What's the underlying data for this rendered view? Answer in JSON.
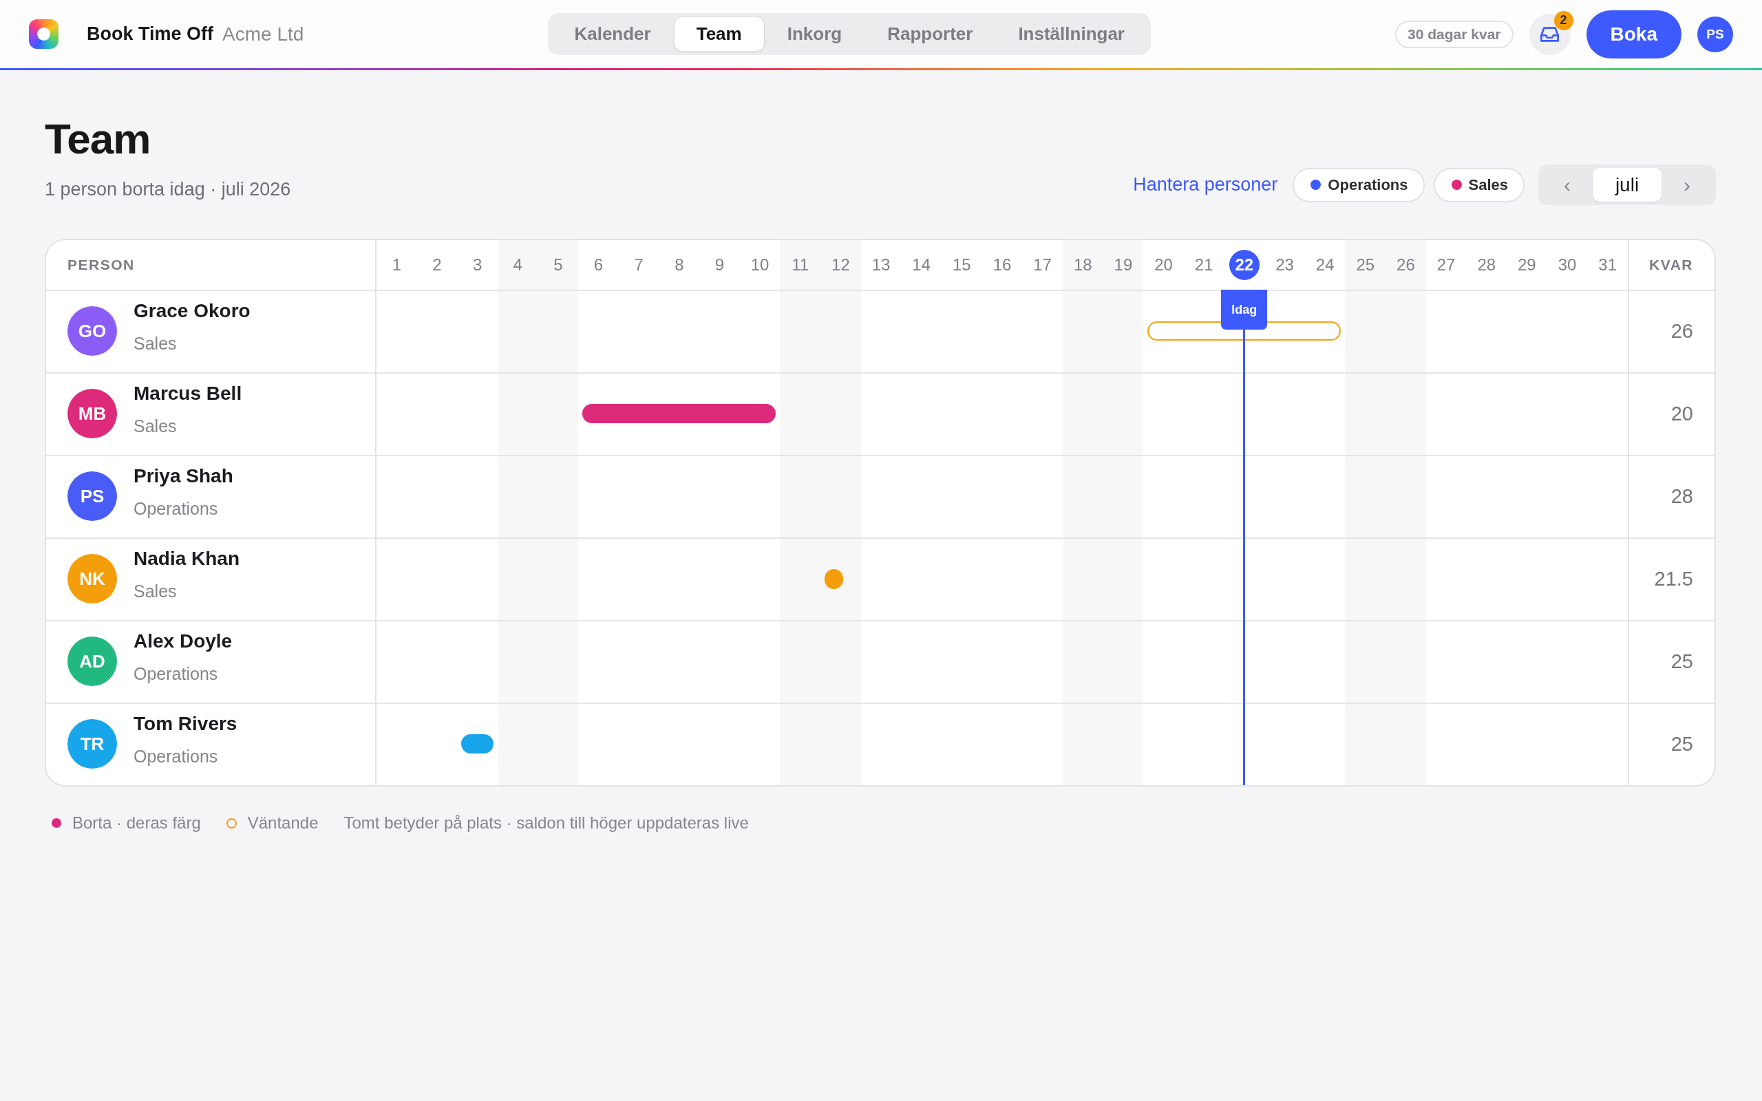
{
  "app": {
    "name": "Book Time Off",
    "org": "Acme Ltd"
  },
  "nav_tabs": [
    {
      "label": "Kalender",
      "selected": false
    },
    {
      "label": "Team",
      "selected": true
    },
    {
      "label": "Inkorg",
      "selected": false
    },
    {
      "label": "Rapporter",
      "selected": false
    },
    {
      "label": "Inställningar",
      "selected": false
    }
  ],
  "top_bar": {
    "balance": "30 dagar kvar",
    "inbox_count": "2",
    "book_button": "Boka",
    "user_initials": "PS"
  },
  "page": {
    "title": "Team",
    "subtitle": "1 person borta idag · juli 2026",
    "manage_link": "Hantera personer"
  },
  "team_filters": [
    {
      "label": "Operations",
      "color": "#3d5afe"
    },
    {
      "label": "Sales",
      "color": "#dd2a7b"
    }
  ],
  "month_nav": {
    "prev": "‹",
    "month": "juli",
    "next": "›"
  },
  "table": {
    "person_header": "PERSON",
    "balance_header": "KVAR",
    "today_label": "Idag",
    "days": [
      {
        "label": "1",
        "weekend": false,
        "today": false
      },
      {
        "label": "2",
        "weekend": false,
        "today": false
      },
      {
        "label": "3",
        "weekend": false,
        "today": false
      },
      {
        "label": "4",
        "weekend": true,
        "today": false
      },
      {
        "label": "5",
        "weekend": true,
        "today": false
      },
      {
        "label": "6",
        "weekend": false,
        "today": false
      },
      {
        "label": "7",
        "weekend": false,
        "today": false
      },
      {
        "label": "8",
        "weekend": false,
        "today": false
      },
      {
        "label": "9",
        "weekend": false,
        "today": false
      },
      {
        "label": "10",
        "weekend": false,
        "today": false
      },
      {
        "label": "11",
        "weekend": true,
        "today": false
      },
      {
        "label": "12",
        "weekend": true,
        "today": false
      },
      {
        "label": "13",
        "weekend": false,
        "today": false
      },
      {
        "label": "14",
        "weekend": false,
        "today": false
      },
      {
        "label": "15",
        "weekend": false,
        "today": false
      },
      {
        "label": "16",
        "weekend": false,
        "today": false
      },
      {
        "label": "17",
        "weekend": false,
        "today": false
      },
      {
        "label": "18",
        "weekend": true,
        "today": false
      },
      {
        "label": "19",
        "weekend": true,
        "today": false
      },
      {
        "label": "20",
        "weekend": false,
        "today": false
      },
      {
        "label": "21",
        "weekend": false,
        "today": false
      },
      {
        "label": "22",
        "weekend": false,
        "today": true
      },
      {
        "label": "23",
        "weekend": false,
        "today": false
      },
      {
        "label": "24",
        "weekend": false,
        "today": false
      },
      {
        "label": "25",
        "weekend": true,
        "today": false
      },
      {
        "label": "26",
        "weekend": true,
        "today": false
      },
      {
        "label": "27",
        "weekend": false,
        "today": false
      },
      {
        "label": "28",
        "weekend": false,
        "today": false
      },
      {
        "label": "29",
        "weekend": false,
        "today": false
      },
      {
        "label": "30",
        "weekend": false,
        "today": false
      },
      {
        "label": "31",
        "weekend": false,
        "today": false
      }
    ],
    "rows": [
      {
        "initials": "GO",
        "name": "Grace Okoro",
        "team": "Sales",
        "color": "#8b5cf6",
        "balance": "26",
        "days": [
          {
            "kind": "none"
          },
          {
            "kind": "none"
          },
          {
            "kind": "none"
          },
          {
            "kind": "none"
          },
          {
            "kind": "none"
          },
          {
            "kind": "none"
          },
          {
            "kind": "none"
          },
          {
            "kind": "none"
          },
          {
            "kind": "none"
          },
          {
            "kind": "none"
          },
          {
            "kind": "none"
          },
          {
            "kind": "none"
          },
          {
            "kind": "none"
          },
          {
            "kind": "none"
          },
          {
            "kind": "none"
          },
          {
            "kind": "none"
          },
          {
            "kind": "none"
          },
          {
            "kind": "none"
          },
          {
            "kind": "none"
          },
          {
            "kind": "pending"
          },
          {
            "kind": "pending"
          },
          {
            "kind": "pending"
          },
          {
            "kind": "pending"
          },
          {
            "kind": "pending"
          },
          {
            "kind": "none"
          },
          {
            "kind": "none"
          },
          {
            "kind": "none"
          },
          {
            "kind": "none"
          },
          {
            "kind": "none"
          },
          {
            "kind": "none"
          },
          {
            "kind": "none"
          }
        ]
      },
      {
        "initials": "MB",
        "name": "Marcus Bell",
        "team": "Sales",
        "color": "#dd2a7b",
        "balance": "20",
        "days": [
          {
            "kind": "none"
          },
          {
            "kind": "none"
          },
          {
            "kind": "none"
          },
          {
            "kind": "none"
          },
          {
            "kind": "none"
          },
          {
            "kind": "away"
          },
          {
            "kind": "away"
          },
          {
            "kind": "away"
          },
          {
            "kind": "away"
          },
          {
            "kind": "away"
          },
          {
            "kind": "none"
          },
          {
            "kind": "none"
          },
          {
            "kind": "none"
          },
          {
            "kind": "none"
          },
          {
            "kind": "none"
          },
          {
            "kind": "none"
          },
          {
            "kind": "none"
          },
          {
            "kind": "none"
          },
          {
            "kind": "none"
          },
          {
            "kind": "none"
          },
          {
            "kind": "none"
          },
          {
            "kind": "none"
          },
          {
            "kind": "none"
          },
          {
            "kind": "none"
          },
          {
            "kind": "none"
          },
          {
            "kind": "none"
          },
          {
            "kind": "none"
          },
          {
            "kind": "none"
          },
          {
            "kind": "none"
          },
          {
            "kind": "none"
          },
          {
            "kind": "none"
          }
        ]
      },
      {
        "initials": "PS",
        "name": "Priya Shah",
        "team": "Operations",
        "color": "#4a5cf6",
        "balance": "28",
        "days": [
          {
            "kind": "none"
          },
          {
            "kind": "none"
          },
          {
            "kind": "none"
          },
          {
            "kind": "none"
          },
          {
            "kind": "none"
          },
          {
            "kind": "none"
          },
          {
            "kind": "none"
          },
          {
            "kind": "none"
          },
          {
            "kind": "none"
          },
          {
            "kind": "none"
          },
          {
            "kind": "none"
          },
          {
            "kind": "none"
          },
          {
            "kind": "none"
          },
          {
            "kind": "none"
          },
          {
            "kind": "none"
          },
          {
            "kind": "none"
          },
          {
            "kind": "none"
          },
          {
            "kind": "none"
          },
          {
            "kind": "none"
          },
          {
            "kind": "none"
          },
          {
            "kind": "none"
          },
          {
            "kind": "none"
          },
          {
            "kind": "none"
          },
          {
            "kind": "none"
          },
          {
            "kind": "none"
          },
          {
            "kind": "none"
          },
          {
            "kind": "none"
          },
          {
            "kind": "none"
          },
          {
            "kind": "none"
          },
          {
            "kind": "none"
          },
          {
            "kind": "none"
          }
        ]
      },
      {
        "initials": "NK",
        "name": "Nadia Khan",
        "team": "Sales",
        "color": "#f59e0b",
        "balance": "21.5",
        "days": [
          {
            "kind": "none"
          },
          {
            "kind": "none"
          },
          {
            "kind": "none"
          },
          {
            "kind": "none"
          },
          {
            "kind": "none"
          },
          {
            "kind": "none"
          },
          {
            "kind": "none"
          },
          {
            "kind": "none"
          },
          {
            "kind": "none"
          },
          {
            "kind": "none"
          },
          {
            "kind": "none"
          },
          {
            "kind": "half"
          },
          {
            "kind": "none"
          },
          {
            "kind": "none"
          },
          {
            "kind": "none"
          },
          {
            "kind": "none"
          },
          {
            "kind": "none"
          },
          {
            "kind": "none"
          },
          {
            "kind": "none"
          },
          {
            "kind": "none"
          },
          {
            "kind": "none"
          },
          {
            "kind": "none"
          },
          {
            "kind": "none"
          },
          {
            "kind": "none"
          },
          {
            "kind": "none"
          },
          {
            "kind": "none"
          },
          {
            "kind": "none"
          },
          {
            "kind": "none"
          },
          {
            "kind": "none"
          },
          {
            "kind": "none"
          },
          {
            "kind": "none"
          }
        ]
      },
      {
        "initials": "AD",
        "name": "Alex Doyle",
        "team": "Operations",
        "color": "#22b981",
        "balance": "25",
        "days": [
          {
            "kind": "none"
          },
          {
            "kind": "none"
          },
          {
            "kind": "none"
          },
          {
            "kind": "none"
          },
          {
            "kind": "none"
          },
          {
            "kind": "none"
          },
          {
            "kind": "none"
          },
          {
            "kind": "none"
          },
          {
            "kind": "none"
          },
          {
            "kind": "none"
          },
          {
            "kind": "none"
          },
          {
            "kind": "none"
          },
          {
            "kind": "none"
          },
          {
            "kind": "none"
          },
          {
            "kind": "none"
          },
          {
            "kind": "none"
          },
          {
            "kind": "none"
          },
          {
            "kind": "none"
          },
          {
            "kind": "none"
          },
          {
            "kind": "none"
          },
          {
            "kind": "none"
          },
          {
            "kind": "none"
          },
          {
            "kind": "none"
          },
          {
            "kind": "none"
          },
          {
            "kind": "none"
          },
          {
            "kind": "none"
          },
          {
            "kind": "none"
          },
          {
            "kind": "none"
          },
          {
            "kind": "none"
          },
          {
            "kind": "none"
          },
          {
            "kind": "none"
          }
        ]
      },
      {
        "initials": "TR",
        "name": "Tom Rivers",
        "team": "Operations",
        "color": "#18a6ea",
        "balance": "25",
        "days": [
          {
            "kind": "none"
          },
          {
            "kind": "none"
          },
          {
            "kind": "away"
          },
          {
            "kind": "none"
          },
          {
            "kind": "none"
          },
          {
            "kind": "none"
          },
          {
            "kind": "none"
          },
          {
            "kind": "none"
          },
          {
            "kind": "none"
          },
          {
            "kind": "none"
          },
          {
            "kind": "none"
          },
          {
            "kind": "none"
          },
          {
            "kind": "none"
          },
          {
            "kind": "none"
          },
          {
            "kind": "none"
          },
          {
            "kind": "none"
          },
          {
            "kind": "none"
          },
          {
            "kind": "none"
          },
          {
            "kind": "none"
          },
          {
            "kind": "none"
          },
          {
            "kind": "none"
          },
          {
            "kind": "none"
          },
          {
            "kind": "none"
          },
          {
            "kind": "none"
          },
          {
            "kind": "none"
          },
          {
            "kind": "none"
          },
          {
            "kind": "none"
          },
          {
            "kind": "none"
          },
          {
            "kind": "none"
          },
          {
            "kind": "none"
          },
          {
            "kind": "none"
          }
        ]
      }
    ]
  },
  "legend": [
    {
      "kind": "filled",
      "color": "#dd2a7b",
      "label": "Borta · deras färg"
    },
    {
      "kind": "ring",
      "color": "#f59e0b",
      "label": "Väntande"
    },
    {
      "kind": "note",
      "label": "Tomt betyder på plats · saldon till höger uppdateras live"
    }
  ]
}
